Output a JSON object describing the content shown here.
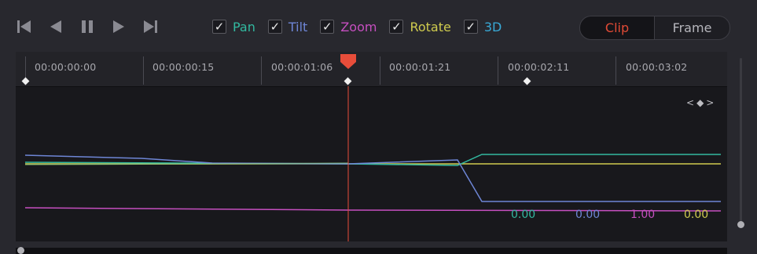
{
  "transport": {
    "buttons": [
      "skip-to-start",
      "previous-frame",
      "pause",
      "play",
      "skip-to-end"
    ]
  },
  "channels": [
    {
      "label": "Pan",
      "checked": true,
      "color": "#32b9a0"
    },
    {
      "label": "Tilt",
      "checked": true,
      "color": "#6e86d6"
    },
    {
      "label": "Zoom",
      "checked": true,
      "color": "#c64fc0"
    },
    {
      "label": "Rotate",
      "checked": true,
      "color": "#cfcb4e"
    },
    {
      "label": "3D",
      "checked": true,
      "color": "#39a9d6"
    }
  ],
  "mode_toggle": {
    "clip_label": "Clip",
    "frame_label": "Frame",
    "selected": "Clip"
  },
  "timeline": {
    "timecodes": [
      "00:00:00:00",
      "00:00:00:15",
      "00:00:01:06",
      "00:00:01:21",
      "00:00:02:11",
      "00:00:03:02"
    ],
    "playhead_color": "#e84d3a"
  },
  "keyframe_nav": {
    "prev": "<",
    "marker": "◆",
    "next": ">"
  },
  "values": {
    "pan": "0.00",
    "tilt": "0.00",
    "zoom": "1.00",
    "rotate": "0.00"
  }
}
